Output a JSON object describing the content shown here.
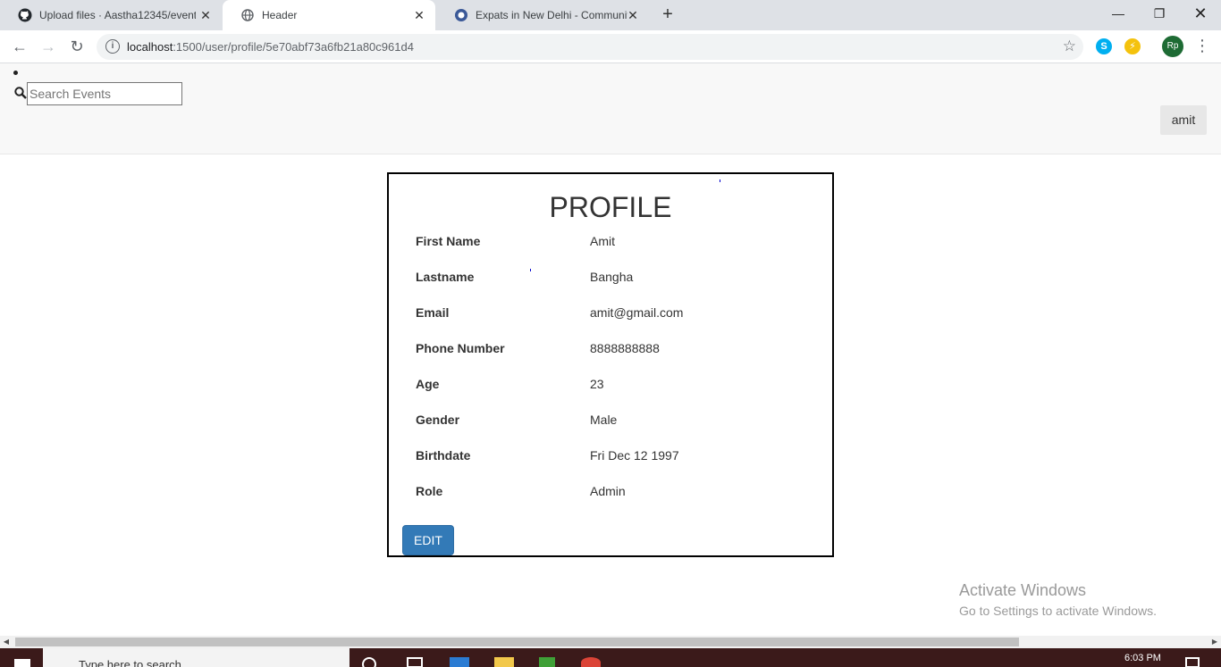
{
  "browser": {
    "tabs": [
      {
        "title": "Upload files · Aastha12345/event",
        "icon": "github-icon"
      },
      {
        "title": "Header",
        "icon": "globe-icon"
      },
      {
        "title": "Expats in New Delhi - Community",
        "icon": "community-icon"
      }
    ],
    "url_host": "localhost",
    "url_path": ":1500/user/profile/5e70abf73a6fb21a80c961d4",
    "avatar_initials": "Rp"
  },
  "header": {
    "search_placeholder": "Search Events",
    "user_button_label": "amit"
  },
  "profile": {
    "title": "PROFILE",
    "fields": [
      {
        "label": "First Name",
        "value": "Amit"
      },
      {
        "label": "Lastname",
        "value": "Bangha"
      },
      {
        "label": "Email",
        "value": "amit@gmail.com"
      },
      {
        "label": "Phone Number",
        "value": "8888888888"
      },
      {
        "label": "Age",
        "value": "23"
      },
      {
        "label": "Gender",
        "value": "Male"
      },
      {
        "label": "Birthdate",
        "value": "Fri Dec 12 1997"
      },
      {
        "label": "Role",
        "value": "Admin"
      }
    ],
    "edit_label": "EDIT"
  },
  "watermark": {
    "line1": "Activate Windows",
    "line2": "Go to Settings to activate Windows."
  },
  "taskbar": {
    "search_text": "Type here to search",
    "time": "6:03 PM"
  },
  "colors": {
    "primary_button": "#337ab7",
    "header_bg": "#f8f8f8",
    "taskbar_bg": "#3b1a1a"
  }
}
